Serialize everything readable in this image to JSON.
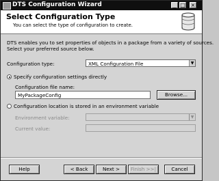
{
  "window": {
    "title": "DTS Configuration Wizard",
    "controls": {
      "minimize": "_",
      "maximize": "□",
      "close": "×"
    }
  },
  "header": {
    "title": "Select Configuration Type",
    "subtitle": "You can select the type of configuration to create."
  },
  "body": {
    "description_line1": "DTS enables you to set properties of objects in a package from a variety of sources.",
    "description_line2": "Select your preferred source below.",
    "configuration_type": {
      "label": "Configuration type:",
      "value": "XML Configuration File"
    },
    "option_direct": {
      "label": "Specify configuration settings directly",
      "checked": true,
      "file_name_label": "Configuration file name:",
      "file_name_value": "MyPackageConfig",
      "browse_label": "Browse..."
    },
    "option_env": {
      "label": "Configuration location is stored in an environment variable",
      "checked": false,
      "env_var_label": "Environment variable:",
      "env_var_value": "",
      "current_value_label": "Current value:",
      "current_value": ""
    }
  },
  "footer": {
    "help": "Help",
    "back": "< Back",
    "next": "Next >",
    "finish": "Finish >>|",
    "cancel": "Cancel"
  },
  "colors": {
    "titlebar": "#0f0f0f",
    "window_bg": "#d4d4d4",
    "header_bg": "#ffffff"
  },
  "icons": [
    "application-icon",
    "database-icon",
    "dropdown-arrow-icon"
  ]
}
